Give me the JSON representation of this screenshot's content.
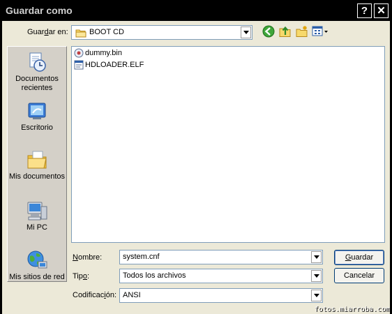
{
  "window": {
    "title": "Guardar como",
    "help_button": "?",
    "close_button": "✕"
  },
  "location": {
    "label_pre": "Guar",
    "label_accel": "d",
    "label_post": "ar en:",
    "value": "BOOT CD"
  },
  "places": [
    {
      "label": "Documentos recientes",
      "icon": "recent-documents-icon"
    },
    {
      "label": "Escritorio",
      "icon": "desktop-icon"
    },
    {
      "label": "Mis documentos",
      "icon": "my-documents-icon"
    },
    {
      "label": "Mi PC",
      "icon": "my-computer-icon"
    },
    {
      "label": "Mis sitios de red",
      "icon": "network-places-icon"
    }
  ],
  "files": [
    {
      "name": "dummy.bin",
      "icon": "bin-file-icon"
    },
    {
      "name": "HDLOADER.ELF",
      "icon": "elf-file-icon"
    }
  ],
  "form": {
    "name_label_accel": "N",
    "name_label_rest": "ombre:",
    "name_value": "system.cnf",
    "type_label_pre": "Tip",
    "type_label_accel": "o",
    "type_label_post": ":",
    "type_value": "Todos los archivos",
    "encoding_label_pre": "Codificac",
    "encoding_label_accel": "i",
    "encoding_label_post": "ón:",
    "encoding_value": "ANSI"
  },
  "buttons": {
    "save_label_accel": "G",
    "save_label_rest": "uardar",
    "cancel_label": "Cancelar"
  },
  "watermark": "fotos.miarroba.com",
  "colors": {
    "titlebar": "#000000",
    "dialog_bg": "#ece9d8",
    "places_bg": "#d4d0c8",
    "field_border": "#7f9db9"
  }
}
